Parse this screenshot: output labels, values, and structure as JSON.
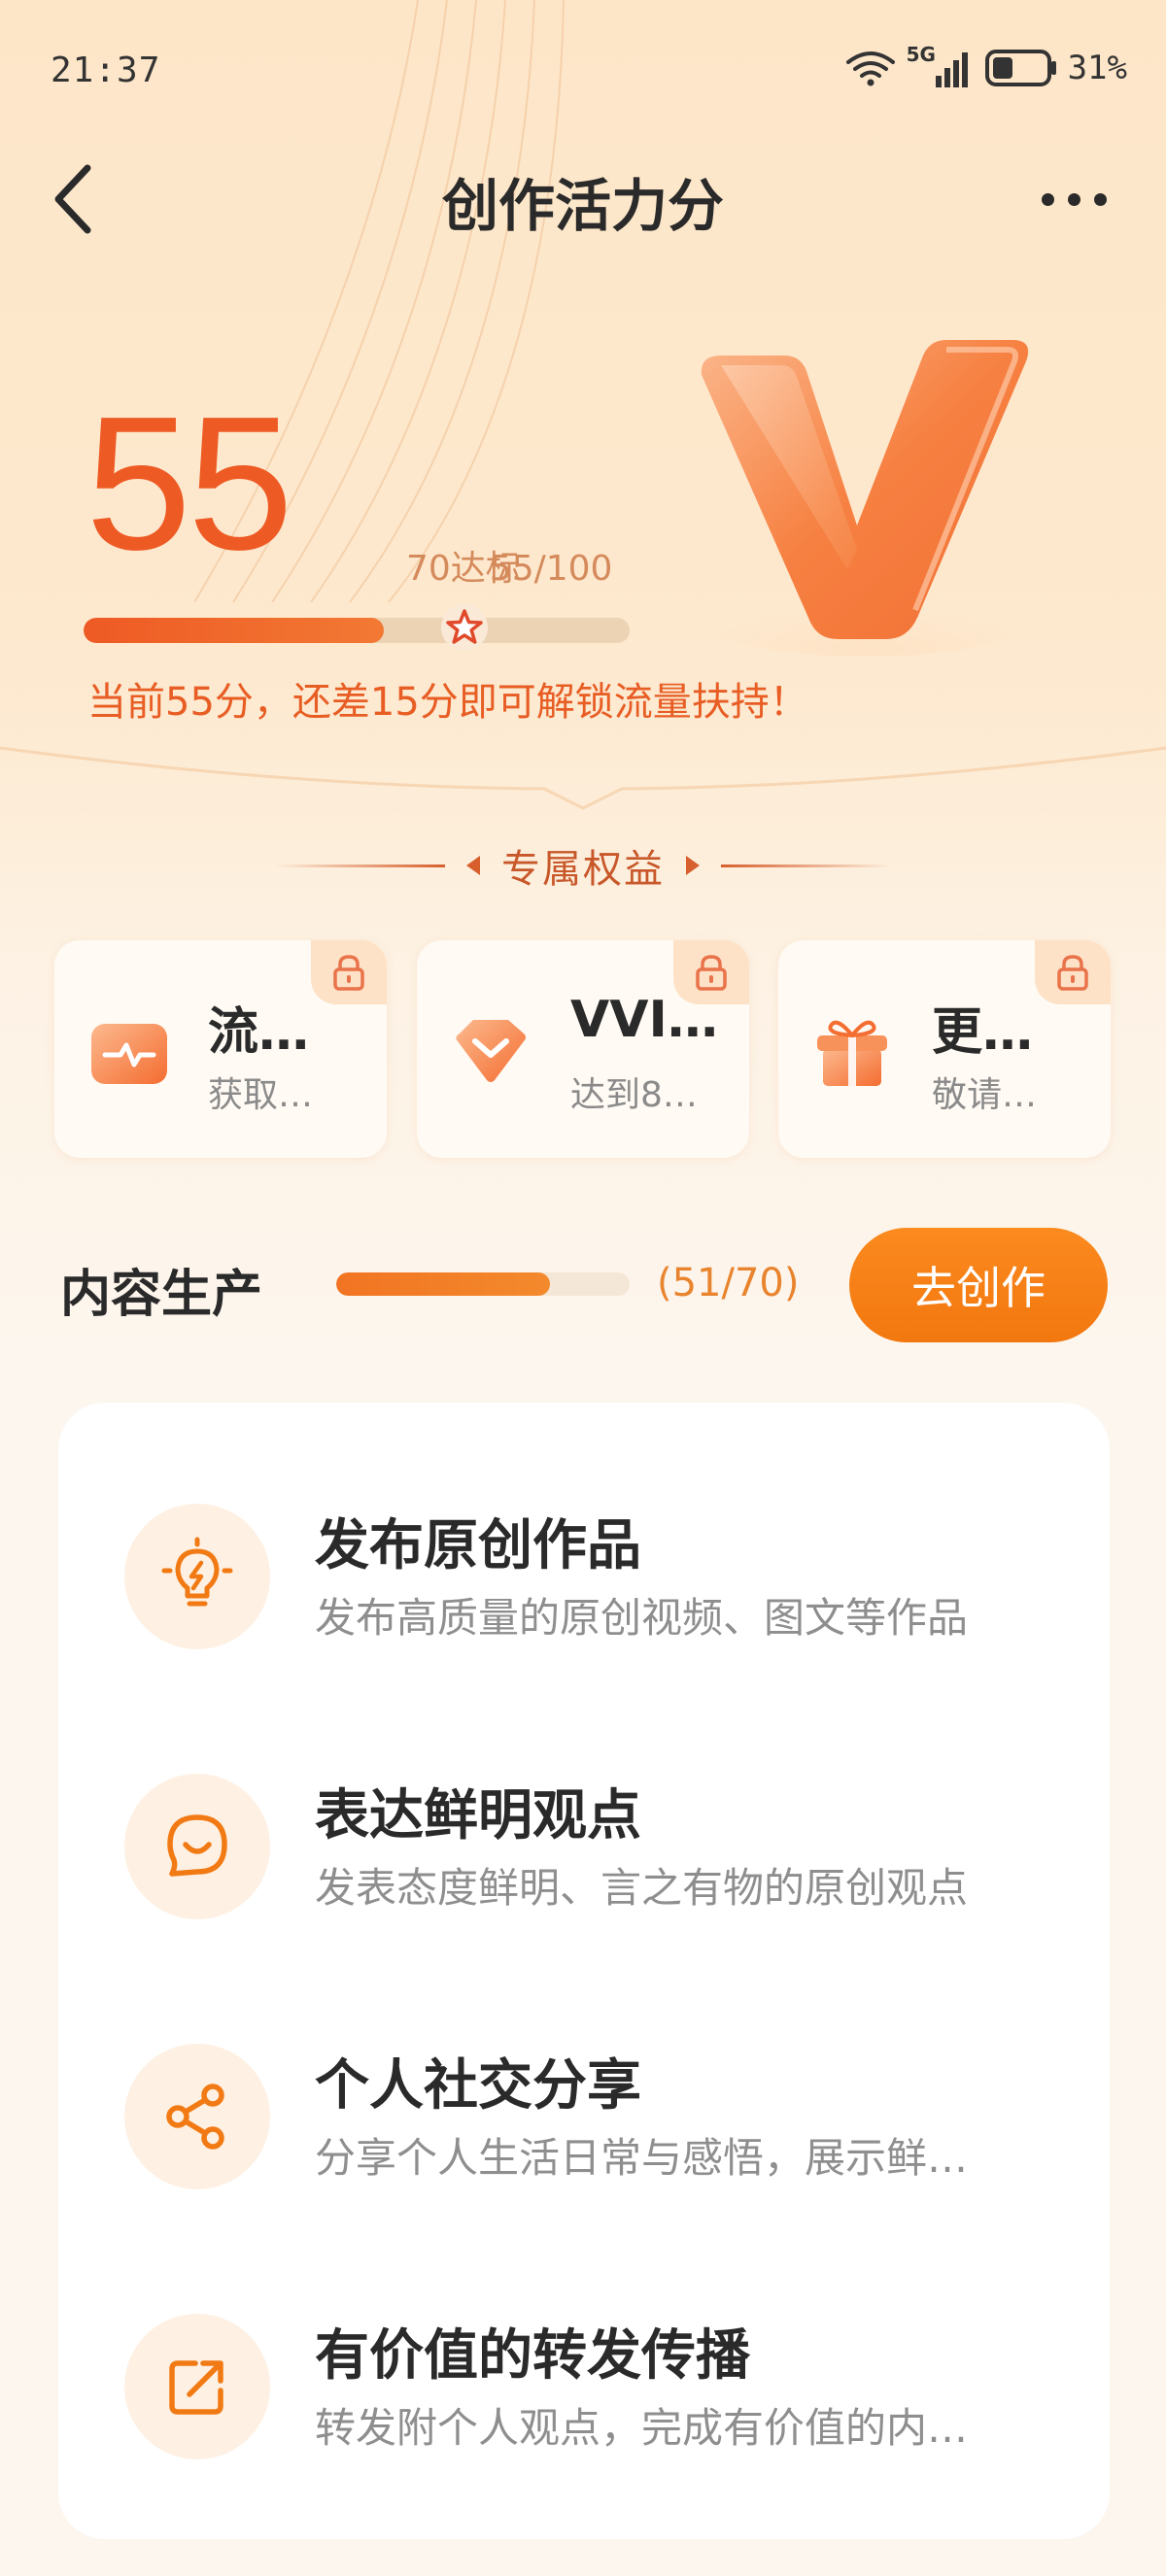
{
  "status_bar": {
    "time": "21:37",
    "network": "5G",
    "battery": "31%"
  },
  "nav": {
    "title": "创作活力分",
    "back_icon": "chevron-left-icon",
    "more_icon": "more-dots-icon"
  },
  "score": {
    "value": "55",
    "target_label": "70达标",
    "max_label": "55/100",
    "progress": 0.55,
    "target_fraction": 0.7,
    "hint": "当前55分，还差15分即可解锁流量扶持！"
  },
  "benefits_section": {
    "title": "专属权益",
    "items": [
      {
        "title": "流…",
        "subtitle": "获取…",
        "icon": "pulse-icon",
        "locked": true
      },
      {
        "title": "VVI…",
        "subtitle": "达到8…",
        "icon": "diamond-v-icon",
        "locked": true
      },
      {
        "title": "更…",
        "subtitle": "敬请…",
        "icon": "gift-icon",
        "locked": true
      }
    ]
  },
  "content_production": {
    "title": "内容生产",
    "progress": 0.7286,
    "count": "(51/70)",
    "button_label": "去创作"
  },
  "tasks": [
    {
      "title": "发布原创作品",
      "desc": "发布高质量的原创视频、图文等作品",
      "icon": "lightbulb-icon"
    },
    {
      "title": "表达鲜明观点",
      "desc": "发表态度鲜明、言之有物的原创观点",
      "icon": "chat-smile-icon"
    },
    {
      "title": "个人社交分享",
      "desc": "分享个人生活日常与感悟，展示鲜…",
      "icon": "share-icon"
    },
    {
      "title": "有价值的转发传播",
      "desc": "转发附个人观点，完成有价值的内…",
      "icon": "forward-icon"
    }
  ],
  "colors": {
    "accent": "#ee5a24",
    "button": "#f5800f",
    "background": "#fde6c8"
  }
}
